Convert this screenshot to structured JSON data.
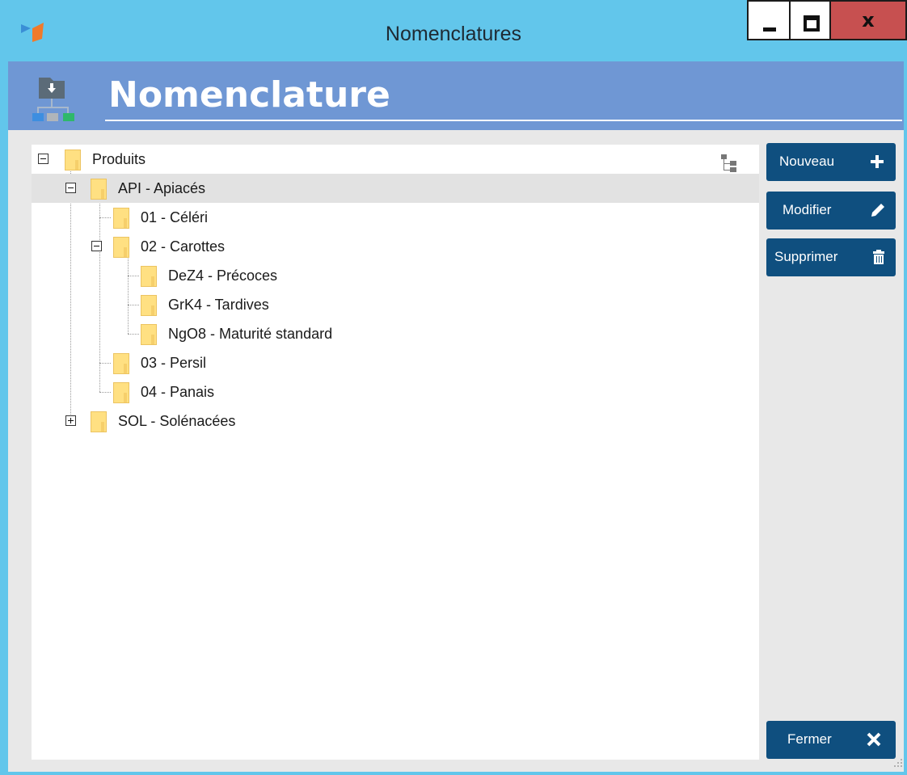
{
  "window": {
    "title": "Nomenclatures",
    "controls": {
      "minimize_icon": "minimize-icon",
      "maximize_icon": "maximize-icon",
      "close_label": "x"
    }
  },
  "header": {
    "title": "Nomenclature",
    "icon": "hierarchy-icon"
  },
  "tree": {
    "toolbar_icon": "tree-view-icon",
    "nodes": [
      {
        "label": "Produits",
        "expanded": true,
        "selected": false
      },
      {
        "label": "API - Apiacés",
        "expanded": true,
        "selected": true
      },
      {
        "label": "01 - Céléri",
        "selected": false
      },
      {
        "label": "02 - Carottes",
        "expanded": true,
        "selected": false
      },
      {
        "label": "DeZ4 - Précoces",
        "selected": false
      },
      {
        "label": "GrK4 - Tardives",
        "selected": false
      },
      {
        "label": "NgO8 - Maturité standard",
        "selected": false
      },
      {
        "label": "03 - Persil",
        "selected": false
      },
      {
        "label": "04 - Panais",
        "selected": false
      },
      {
        "label": "SOL - Solénacées",
        "expanded": false,
        "selected": false
      }
    ]
  },
  "actions": {
    "new_label": "Nouveau",
    "edit_label": "Modifier",
    "delete_label": "Supprimer",
    "close_label": "Fermer"
  },
  "colors": {
    "window_frame": "#62c6eb",
    "header_band": "#6f97d4",
    "button": "#0f4f7f",
    "close_button": "#c75050",
    "folder": "#ffe082",
    "selection": "#e2e2e2"
  }
}
